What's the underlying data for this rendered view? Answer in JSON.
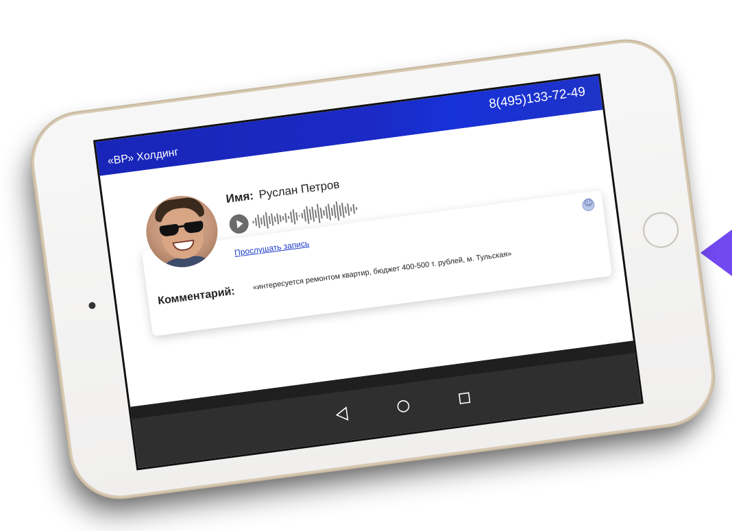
{
  "app": {
    "company_name": "«ВР» Холдинг",
    "phone": "8(495)133-72-49",
    "header_color": "#1b2ac4"
  },
  "contact": {
    "name_label": "Имя:",
    "name_value": "Руслан Петров",
    "listen_label": "Прослушать запись"
  },
  "comment": {
    "label": "Комментарий:",
    "text": "«интересуется ремонтом квартир, бюджет 400-500 т. рублей, м. Тульская»"
  },
  "icons": {
    "play": "play-icon",
    "emoji": "smiley-icon",
    "back": "back-triangle-icon",
    "home": "home-circle-icon",
    "recent": "recent-square-icon"
  },
  "colors": {
    "accent_purple": "#6a3ff0",
    "nav_bar": "#2f2f2f",
    "link": "#1a3bc9"
  }
}
